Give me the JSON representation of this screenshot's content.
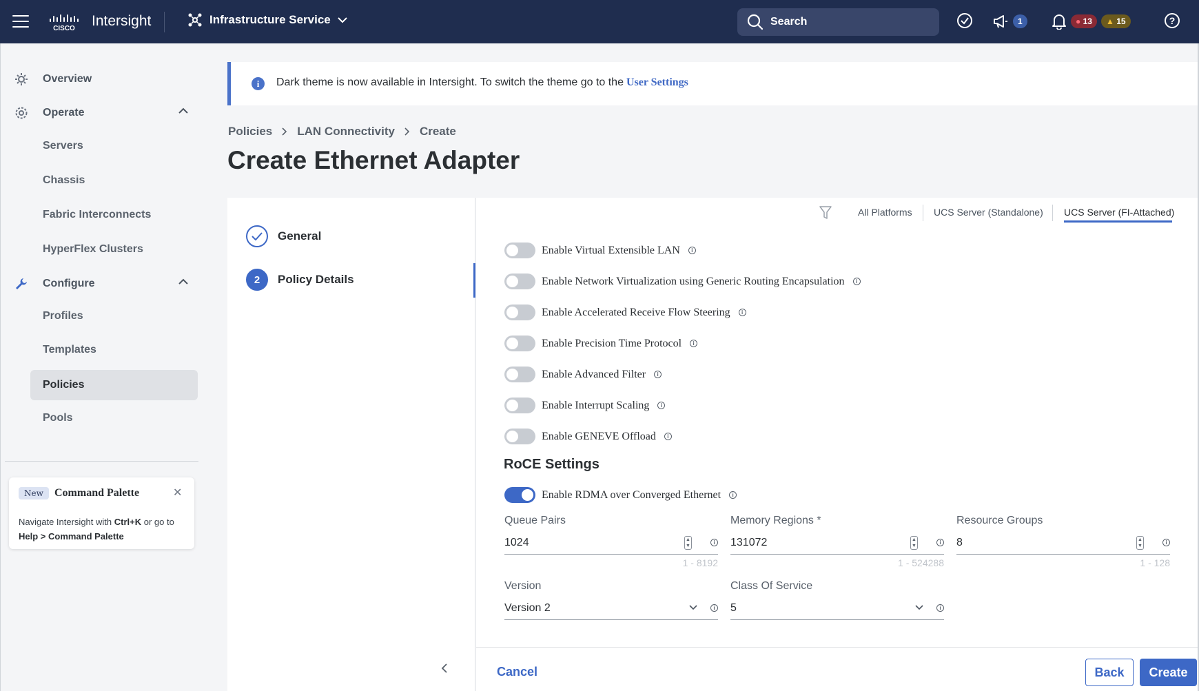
{
  "topbar": {
    "app_name": "Intersight",
    "service": "Infrastructure Service",
    "search_label": "Search",
    "announcements_count": "1",
    "critical_alarms": "13",
    "warning_alarms": "15"
  },
  "sidebar": {
    "overview": "Overview",
    "operate": "Operate",
    "operate_items": [
      "Servers",
      "Chassis",
      "Fabric Interconnects",
      "HyperFlex Clusters"
    ],
    "configure": "Configure",
    "configure_items": [
      "Profiles",
      "Templates",
      "Policies",
      "Pools"
    ],
    "active_item": "Policies",
    "palette": {
      "badge": "New",
      "title": "Command Palette",
      "text_1": "Navigate Intersight with ",
      "shortcut": "Ctrl+K",
      "text_2": " or go to ",
      "path": "Help > Command Palette"
    }
  },
  "banner": {
    "message": "Dark theme is now available in Intersight. To switch the theme go to the",
    "link": "User Settings"
  },
  "breadcrumb": [
    "Policies",
    "LAN Connectivity",
    "Create"
  ],
  "page_title": "Create Ethernet Adapter",
  "steps": [
    {
      "number": "1",
      "label": "General",
      "state": "complete"
    },
    {
      "number": "2",
      "label": "Policy Details",
      "state": "active"
    }
  ],
  "platform_tabs": [
    "All Platforms",
    "UCS Server (Standalone)",
    "UCS Server (FI-Attached)"
  ],
  "active_platform_tab": "UCS Server (FI-Attached)",
  "toggles": [
    {
      "label": "Enable Virtual Extensible LAN",
      "on": false
    },
    {
      "label": "Enable Network Virtualization using Generic Routing Encapsulation",
      "on": false
    },
    {
      "label": "Enable Accelerated Receive Flow Steering",
      "on": false
    },
    {
      "label": "Enable Precision Time Protocol",
      "on": false
    },
    {
      "label": "Enable Advanced Filter",
      "on": false
    },
    {
      "label": "Enable Interrupt Scaling",
      "on": false
    },
    {
      "label": "Enable GENEVE Offload",
      "on": false
    }
  ],
  "roce": {
    "section_title": "RoCE Settings",
    "toggle_label": "Enable RDMA over Converged Ethernet",
    "toggle_on": true,
    "queue_pairs": {
      "label": "Queue Pairs",
      "value": "1024",
      "range": "1 - 8192"
    },
    "memory_regions": {
      "label": "Memory Regions *",
      "value": "131072",
      "range": "1 - 524288"
    },
    "resource_groups": {
      "label": "Resource Groups",
      "value": "8",
      "range": "1 - 128"
    },
    "version": {
      "label": "Version",
      "value": "Version 2"
    },
    "class_of_service": {
      "label": "Class Of Service",
      "value": "5"
    }
  },
  "footer": {
    "cancel": "Cancel",
    "back": "Back",
    "create": "Create"
  },
  "colors": {
    "topbar": "#1f2d4f",
    "accent": "#3d68c6"
  }
}
